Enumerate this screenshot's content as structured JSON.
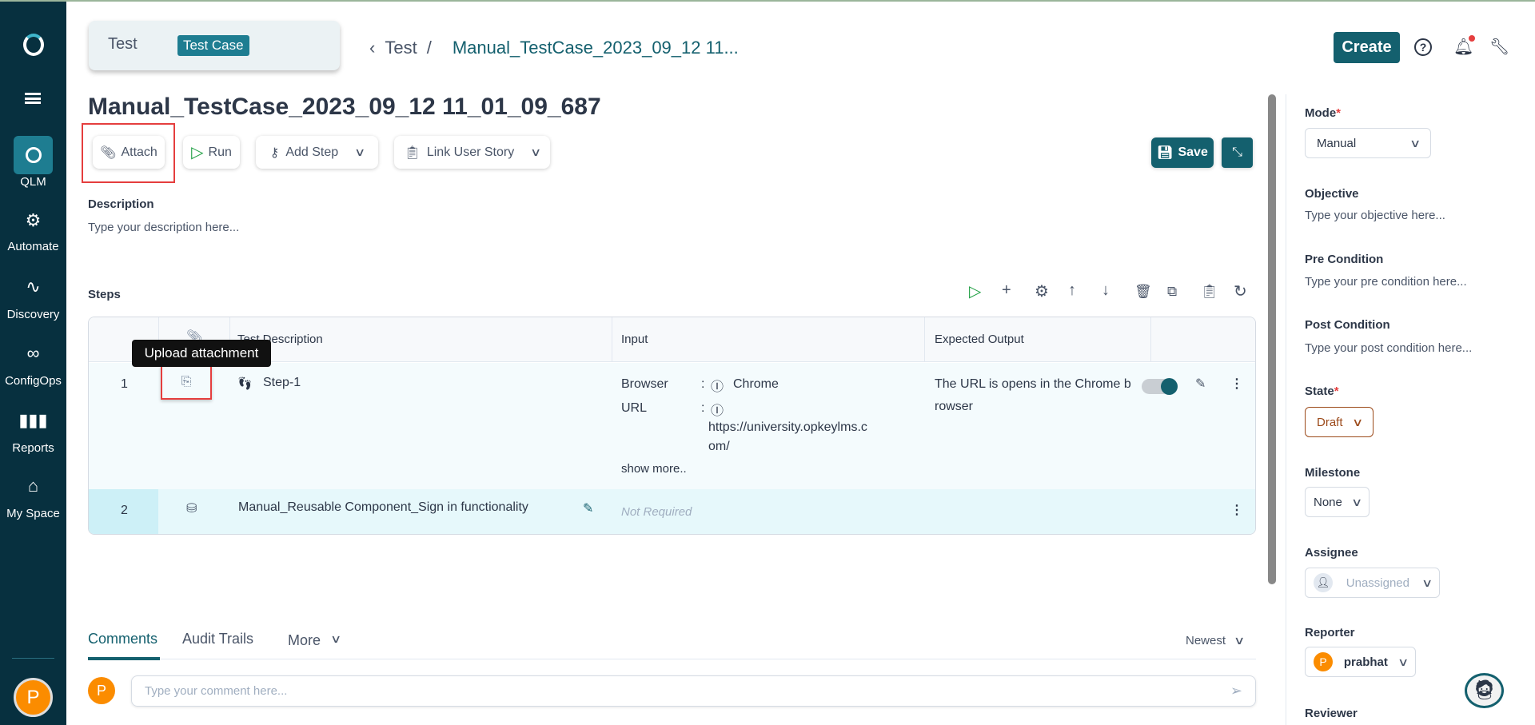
{
  "sidebar": {
    "items": [
      {
        "label": "QLM",
        "icon": "target-icon"
      },
      {
        "label": "Automate",
        "icon": "gears-icon"
      },
      {
        "label": "Discovery",
        "icon": "pulse-icon"
      },
      {
        "label": "ConfigOps",
        "icon": "infinity-icon"
      },
      {
        "label": "Reports",
        "icon": "bar-chart-icon"
      },
      {
        "label": "My Space",
        "icon": "home-icon"
      }
    ],
    "avatar": "P"
  },
  "header": {
    "project": "Test",
    "type_badge": "Test Case",
    "breadcrumb_parent": "Test",
    "breadcrumb_sep": "/",
    "breadcrumb_current": "Manual_TestCase_2023_09_12 11...",
    "create_label": "Create"
  },
  "page": {
    "title": "Manual_TestCase_2023_09_12 11_01_09_687"
  },
  "toolbar": {
    "attach": "Attach",
    "run": "Run",
    "add_step": "Add Step",
    "link_user_story": "Link User Story",
    "save": "Save"
  },
  "description": {
    "label": "Description",
    "placeholder": "Type your description here..."
  },
  "steps": {
    "label": "Steps",
    "columns": [
      "Test Description",
      "Input",
      "Expected Output"
    ],
    "tooltip": "Upload attachment",
    "rows": [
      {
        "num": "1",
        "desc": "Step-1",
        "inputs": [
          {
            "key": "Browser",
            "value": "Chrome"
          },
          {
            "key": "URL",
            "value": "https://university.opkeylms.c",
            "value2": "om/"
          }
        ],
        "show_more": "show more..",
        "expected": "The URL is opens in the Chrome b",
        "expected2": "rowser",
        "toggle_on": true
      },
      {
        "num": "2",
        "desc": "Manual_Reusable Component_Sign in functionality",
        "input": "Not Required"
      }
    ]
  },
  "bottom": {
    "tabs": [
      "Comments",
      "Audit Trails",
      "More"
    ],
    "sort": "Newest",
    "comment_placeholder": "Type your comment here...",
    "avatar": "P"
  },
  "panel": {
    "mode": {
      "label": "Mode",
      "value": "Manual"
    },
    "objective": {
      "label": "Objective",
      "placeholder": "Type your objective here..."
    },
    "pre": {
      "label": "Pre Condition",
      "placeholder": "Type your pre condition here..."
    },
    "post": {
      "label": "Post Condition",
      "placeholder": "Type your post condition here..."
    },
    "state": {
      "label": "State",
      "value": "Draft"
    },
    "milestone": {
      "label": "Milestone",
      "value": "None"
    },
    "assignee": {
      "label": "Assignee",
      "value": "Unassigned"
    },
    "reporter": {
      "label": "Reporter",
      "value": "prabhat",
      "avatar": "P"
    },
    "reviewer": {
      "label": "Reviewer"
    },
    "required": "*"
  },
  "colors": {
    "sidebar": "#07303f",
    "accent": "#14606e",
    "highlight": "#e53e3e",
    "avatar": "#fb8c00"
  }
}
